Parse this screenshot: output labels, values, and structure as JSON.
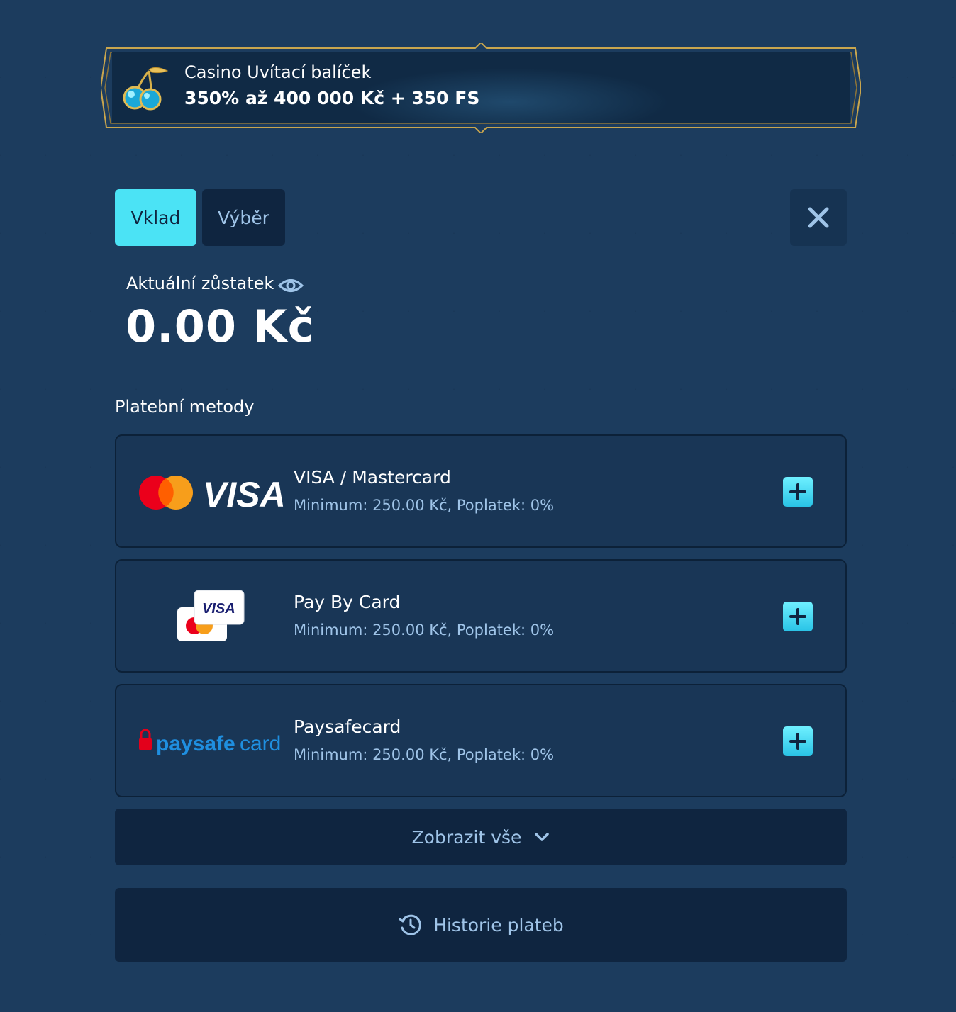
{
  "banner": {
    "title": "Casino Uvítací balíček",
    "offer": "350% až 400 000 Kč + 350 FS",
    "icon": "cherries-icon"
  },
  "tabs": [
    {
      "label": "Vklad",
      "active": true
    },
    {
      "label": "Výběr",
      "active": false
    }
  ],
  "balance": {
    "label": "Aktuální zůstatek",
    "value": "0.00 Kč"
  },
  "payment_methods": {
    "title": "Platební metody",
    "items": [
      {
        "name": "VISA / Mastercard",
        "info": "Minimum: 250.00 Kč, Poplatek: 0%",
        "logo": "visa-mastercard-logo"
      },
      {
        "name": "Pay By Card",
        "info": "Minimum: 250.00 Kč, Poplatek: 0%",
        "logo": "pay-by-card-logo"
      },
      {
        "name": "Paysafecard",
        "info": "Minimum: 250.00 Kč, Poplatek: 0%",
        "logo": "paysafecard-logo"
      }
    ]
  },
  "logos": {
    "visa_text": "VISA",
    "paysafe_bold": "paysafe",
    "paysafe_light": "card"
  },
  "show_all_label": "Zobrazit vše",
  "history_label": "Historie plateb",
  "colors": {
    "accent": "#4be3f5",
    "background": "#1c3c5e",
    "panel": "#0f2540",
    "card": "#193656",
    "muted_text": "#9fc4e8",
    "gold": "#c9a64e"
  }
}
